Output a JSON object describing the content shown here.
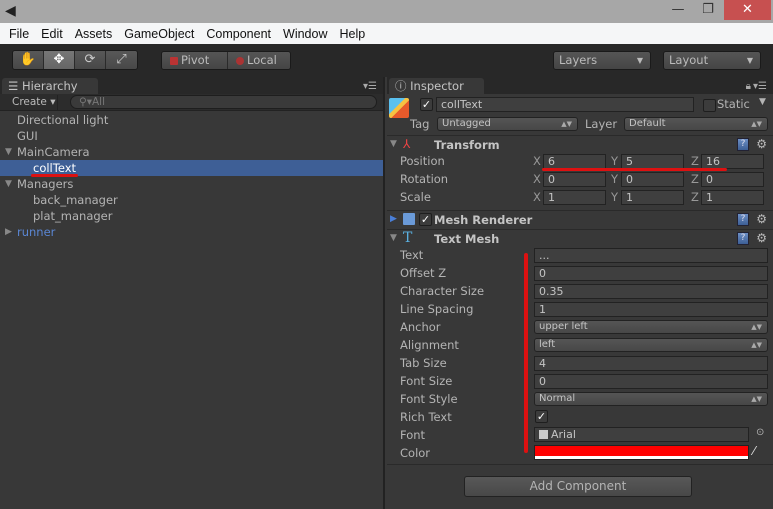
{
  "window": {
    "logo": "unity-logo-icon",
    "controls": {
      "minimize": "—",
      "maximize": "❐",
      "close": "✕"
    }
  },
  "menu": [
    "File",
    "Edit",
    "Assets",
    "GameObject",
    "Component",
    "Window",
    "Help"
  ],
  "toolbar": {
    "tools": [
      {
        "name": "hand-tool",
        "glyph": "✋",
        "active": false
      },
      {
        "name": "move-tool",
        "glyph": "✥",
        "active": true
      },
      {
        "name": "rotate-tool",
        "glyph": "⟳",
        "active": false
      },
      {
        "name": "scale-tool",
        "glyph": "⤢",
        "active": false
      }
    ],
    "pivot_label": "Pivot",
    "local_label": "Local",
    "layers_label": "Layers",
    "layout_label": "Layout"
  },
  "hierarchy": {
    "tab_label": "Hierarchy",
    "create_label": "Create ▾",
    "search_placeholder": "All",
    "items": [
      {
        "label": "Directional light",
        "depth": 0,
        "expander": "",
        "selected": false,
        "link": false
      },
      {
        "label": "GUI",
        "depth": 0,
        "expander": "",
        "selected": false,
        "link": false
      },
      {
        "label": "MainCamera",
        "depth": 0,
        "expander": "▼",
        "selected": false,
        "link": false
      },
      {
        "label": "collText",
        "depth": 1,
        "expander": "",
        "selected": true,
        "link": false
      },
      {
        "label": "Managers",
        "depth": 0,
        "expander": "▼",
        "selected": false,
        "link": false
      },
      {
        "label": "back_manager",
        "depth": 1,
        "expander": "",
        "selected": false,
        "link": false
      },
      {
        "label": "plat_manager",
        "depth": 1,
        "expander": "",
        "selected": false,
        "link": false
      },
      {
        "label": "runner",
        "depth": 0,
        "expander": "▶",
        "selected": false,
        "link": true
      }
    ]
  },
  "inspector": {
    "tab_label": "Inspector",
    "object_name": "collText",
    "active": true,
    "static_label": "Static",
    "static_checked": false,
    "tag_label": "Tag",
    "tag_value": "Untagged",
    "layer_label": "Layer",
    "layer_value": "Default",
    "transform": {
      "title": "Transform",
      "rows": [
        {
          "label": "Position",
          "x": "6",
          "y": "5",
          "z": "16"
        },
        {
          "label": "Rotation",
          "x": "0",
          "y": "0",
          "z": "0"
        },
        {
          "label": "Scale",
          "x": "1",
          "y": "1",
          "z": "1"
        }
      ],
      "axis": [
        "X",
        "Y",
        "Z"
      ]
    },
    "mesh_renderer": {
      "title": "Mesh Renderer",
      "enabled": true
    },
    "text_mesh": {
      "title": "Text Mesh",
      "text_label": "Text",
      "text_value": "...",
      "offset_z_label": "Offset Z",
      "offset_z": "0",
      "char_size_label": "Character Size",
      "char_size": "0.35",
      "line_spacing_label": "Line Spacing",
      "line_spacing": "1",
      "anchor_label": "Anchor",
      "anchor": "upper left",
      "alignment_label": "Alignment",
      "alignment": "left",
      "tab_size_label": "Tab Size",
      "tab_size": "4",
      "font_size_label": "Font Size",
      "font_size": "0",
      "font_style_label": "Font Style",
      "font_style": "Normal",
      "rich_text_label": "Rich Text",
      "rich_text": true,
      "font_label": "Font",
      "font": "Arial",
      "color_label": "Color",
      "color": "#ff0000"
    },
    "add_component_label": "Add Component"
  },
  "annotations": {
    "color": "#dd1111"
  }
}
